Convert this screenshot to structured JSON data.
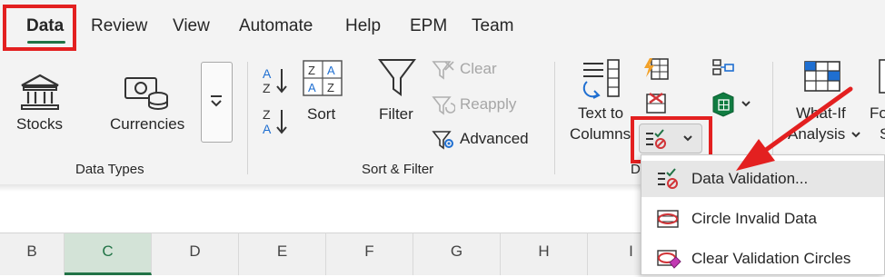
{
  "tabs": [
    {
      "label": "Data"
    },
    {
      "label": "Review"
    },
    {
      "label": "View"
    },
    {
      "label": "Automate"
    },
    {
      "label": "Help"
    },
    {
      "label": "EPM"
    },
    {
      "label": "Team"
    }
  ],
  "data_types": {
    "stocks_label": "Stocks",
    "currencies_label": "Currencies",
    "group_label": "Data Types"
  },
  "sort_filter": {
    "sort_label": "Sort",
    "filter_label": "Filter",
    "clear_label": "Clear",
    "reapply_label": "Reapply",
    "advanced_label": "Advanced",
    "group_label": "Sort & Filter"
  },
  "data_tools": {
    "text_to_columns_line1": "Text to",
    "text_to_columns_line2": "Columns",
    "group_label_partial": "D"
  },
  "forecast": {
    "what_if_line1": "What-If",
    "what_if_line2": "Analysis",
    "forecast_partial_line1": "Fo",
    "forecast_partial_line2": "S"
  },
  "validation_menu": {
    "items": [
      {
        "label": "Data Validation..."
      },
      {
        "label": "Circle Invalid Data"
      },
      {
        "label": "Clear Validation Circles"
      }
    ]
  },
  "columns": [
    "B",
    "C",
    "D",
    "E",
    "F",
    "G",
    "H",
    "I"
  ],
  "selected_column": "C",
  "colors": {
    "accent": "#217346",
    "highlight_red": "#e32020",
    "link_blue": "#1f6fd1"
  }
}
